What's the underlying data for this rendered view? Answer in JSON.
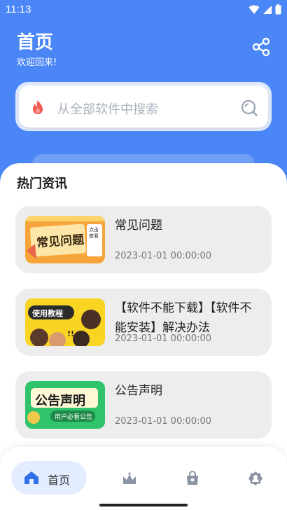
{
  "status_bar": {
    "time": "11:13"
  },
  "header": {
    "title": "首页",
    "subtitle": "欢迎回来!"
  },
  "search": {
    "placeholder": "从全部软件中搜索"
  },
  "section": {
    "title": "热门资讯"
  },
  "news": [
    {
      "title": "常见问题",
      "date": "2023-01-01 00:00:00",
      "thumb_text": "常见问题",
      "thumb_side": "点击查看"
    },
    {
      "title": "【软件不能下载】【软件不能安装】解决办法",
      "date": "2023-01-01 00:00:00",
      "thumb_text": "使用教程",
      "thumb_side": "!!"
    },
    {
      "title": "公告声明",
      "date": "2023-01-01 00:00:00",
      "thumb_text": "公告声明",
      "thumb_side": "用户必看公告"
    }
  ],
  "nav": {
    "home_label": "首页"
  },
  "colors": {
    "accent": "#4a86f5",
    "nav_active_bg": "#e4edff"
  }
}
